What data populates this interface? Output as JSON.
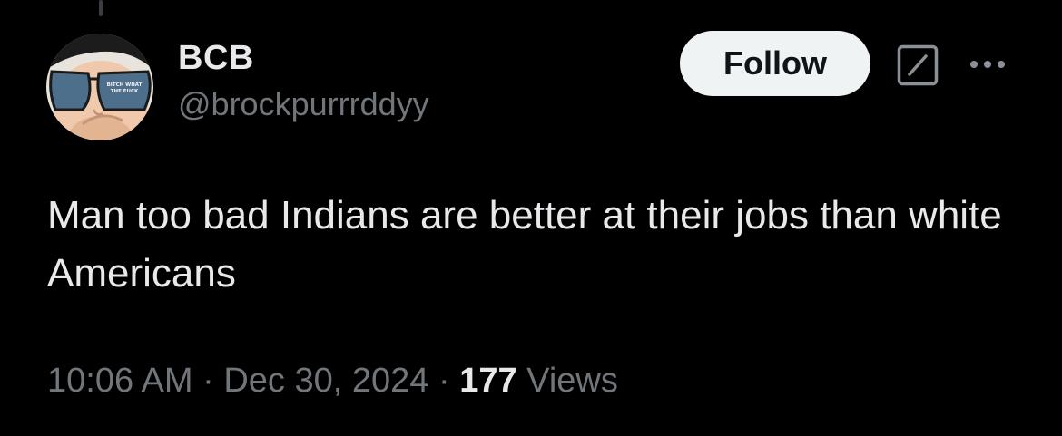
{
  "tweet": {
    "display_name": "BCB",
    "handle": "@brockpurrrddyy",
    "follow_label": "Follow",
    "text": "Man too bad Indians are better at their jobs than white Americans",
    "time": "10:06 AM",
    "separator": "·",
    "date": "Dec 30, 2024",
    "views_count": "177",
    "views_label": "Views"
  },
  "icons": {
    "avatar": "avatar-cartoon-sunglasses",
    "grok": "grok-icon",
    "more": "more-horizontal-icon"
  },
  "avatar_lens_text": {
    "line1": "BITCH WHAT",
    "line2": "THE FUCK"
  },
  "colors": {
    "background": "#000000",
    "primary_text": "#e7e9ea",
    "secondary_text": "#71767b",
    "follow_bg": "#eff3f4",
    "follow_text": "#0f1419"
  }
}
